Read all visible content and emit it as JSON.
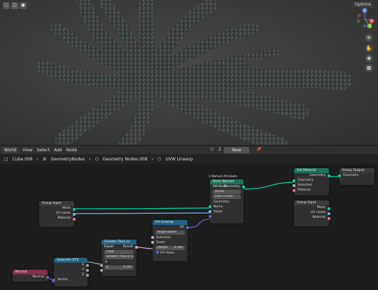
{
  "viewport": {
    "options_label": "Options",
    "nav": [
      "hand-icon",
      "camera-icon",
      "grid-icon"
    ],
    "gizmo": {
      "x": "X",
      "y": "Y",
      "z": "Z"
    }
  },
  "header": {
    "items": [
      "World",
      "View",
      "Select",
      "Add",
      "Node"
    ],
    "new_label": "New",
    "slot": "2"
  },
  "breadcrumbs": [
    "Cube.006",
    "GeometryNodes",
    "Geometry Nodes.008",
    "UVW Unwarp"
  ],
  "attr_panel": {
    "line1": "1 Named Attribute",
    "line2": "Store Named Attribute"
  },
  "nodes": {
    "group_input_a": {
      "title": "Group Input",
      "rows": [
        "Mesh",
        "UV name",
        "Material"
      ]
    },
    "store_named": {
      "title": "Store Named Attribute",
      "rows": [
        "Geometry",
        "Vector",
        "Face Corner",
        "Geometry",
        "Name",
        "Value"
      ]
    },
    "set_material": {
      "title": "Set Material",
      "rows": [
        "Geometry",
        "Geometry",
        "Selection",
        "Material"
      ]
    },
    "group_output": {
      "title": "Group Output",
      "rows": [
        "Geometry",
        "Geometry"
      ]
    },
    "group_input_b": {
      "title": "Group Input",
      "rows": [
        "Mesh",
        "UV name",
        "Material"
      ]
    },
    "uv_unwrap": {
      "title": "UV Unwrap",
      "rows": [
        "UV",
        "Angle Based",
        "Selection",
        "Seam",
        "Margin",
        "0.100",
        "Fill Holes"
      ]
    },
    "greater_than": {
      "title": "Greater Than or Equal",
      "rows": [
        "Result",
        "Float",
        "Greater Than or E...",
        "A",
        "B",
        "0.100"
      ]
    },
    "separate_xyz": {
      "title": "Separate XYZ",
      "rows": [
        "X",
        "Y",
        "Z",
        "Vector"
      ]
    },
    "normal": {
      "title": "Normal",
      "rows": [
        "Normal"
      ]
    }
  },
  "colors": {
    "geometry": "#00d6a3",
    "float": "#a1a1a1",
    "vector": "#6363c7",
    "string": "#70b2ff",
    "bool": "#cca6d6",
    "material": "#eb7582",
    "input_header": "#3c3c3c",
    "converter_header": "#246283",
    "output_header": "#3c3c3c",
    "attribute_header": "#1d725e"
  }
}
